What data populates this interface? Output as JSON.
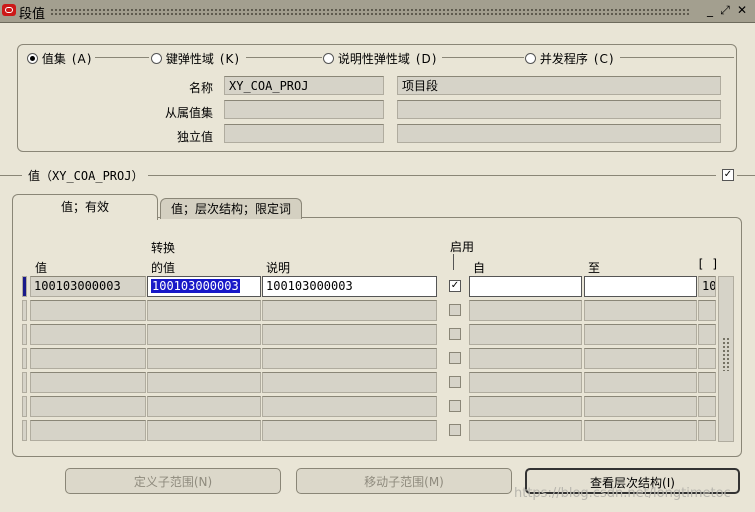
{
  "window": {
    "title": "段值"
  },
  "radios": [
    {
      "label": "值集",
      "key": "(A)",
      "selected": true
    },
    {
      "label": "键弹性域",
      "key": "(K)",
      "selected": false
    },
    {
      "label": "说明性弹性域",
      "key": "(D)",
      "selected": false
    },
    {
      "label": "并发程序",
      "key": "(C)",
      "selected": false
    }
  ],
  "header_fields": {
    "name_label": "名称",
    "name_value": "XY_COA_PROJ",
    "name_desc": "项目段",
    "dependent_label": "从属值集",
    "independent_label": "独立值"
  },
  "section": {
    "title": "值（XY_COA_PROJ）"
  },
  "tabs": [
    {
      "label": "值；有效"
    },
    {
      "label": "值；层次结构；限定词"
    }
  ],
  "columns": {
    "value": "值",
    "translated_1": "转换",
    "translated_2": "的值",
    "description": "说明",
    "enabled": "启用",
    "from": "自",
    "to": "至",
    "extra": "[ ]"
  },
  "rows": [
    {
      "value": "100103000003",
      "translated": "100103000003",
      "description": "100103000003",
      "enabled": true,
      "from": "",
      "to": "",
      "extra": "10"
    },
    {
      "value": "",
      "translated": "",
      "description": "",
      "enabled": false,
      "from": "",
      "to": "",
      "extra": ""
    },
    {
      "value": "",
      "translated": "",
      "description": "",
      "enabled": false,
      "from": "",
      "to": "",
      "extra": ""
    },
    {
      "value": "",
      "translated": "",
      "description": "",
      "enabled": false,
      "from": "",
      "to": "",
      "extra": ""
    },
    {
      "value": "",
      "translated": "",
      "description": "",
      "enabled": false,
      "from": "",
      "to": "",
      "extra": ""
    },
    {
      "value": "",
      "translated": "",
      "description": "",
      "enabled": false,
      "from": "",
      "to": "",
      "extra": ""
    },
    {
      "value": "",
      "translated": "",
      "description": "",
      "enabled": false,
      "from": "",
      "to": "",
      "extra": ""
    }
  ],
  "buttons": {
    "define_subrange": "定义子范围(N)",
    "move_subrange": "移动子范围(M)",
    "view_hierarchy": "查看层次结构(I)"
  },
  "watermark": "https://blog.csdn.net/longtimetoc"
}
